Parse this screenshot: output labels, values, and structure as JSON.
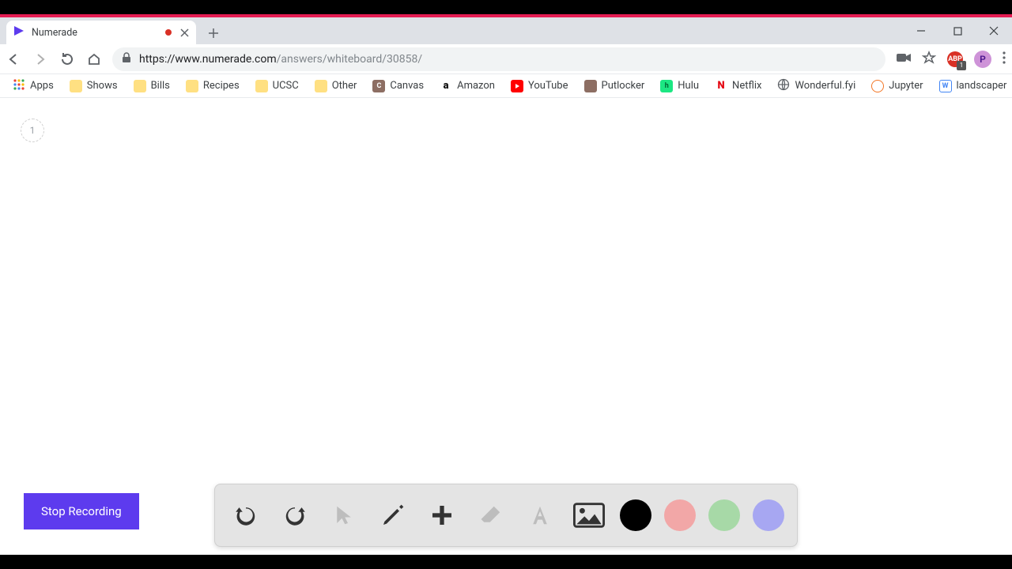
{
  "tab": {
    "title": "Numerade"
  },
  "url": {
    "prefix": "https://www.numerade.com",
    "path": "/answers/whiteboard/30858/"
  },
  "extensions": {
    "abp_label": "ABP",
    "abp_badge": "1"
  },
  "profile": {
    "initial": "P"
  },
  "bookmarks": [
    {
      "label": "Apps",
      "icon": "apps"
    },
    {
      "label": "Shows",
      "icon": "folder"
    },
    {
      "label": "Bills",
      "icon": "folder"
    },
    {
      "label": "Recipes",
      "icon": "folder"
    },
    {
      "label": "UCSC",
      "icon": "folder"
    },
    {
      "label": "Other",
      "icon": "folder"
    },
    {
      "label": "Canvas",
      "icon": "canvas"
    },
    {
      "label": "Amazon",
      "icon": "amazon"
    },
    {
      "label": "YouTube",
      "icon": "youtube"
    },
    {
      "label": "Putlocker",
      "icon": "putlocker"
    },
    {
      "label": "Hulu",
      "icon": "hulu"
    },
    {
      "label": "Netflix",
      "icon": "netflix"
    },
    {
      "label": "Wonderful.fyi",
      "icon": "globe"
    },
    {
      "label": "Jupyter",
      "icon": "jupyter"
    },
    {
      "label": "landscaper",
      "icon": "landscaper"
    }
  ],
  "bm_overflow": "»",
  "whiteboard": {
    "page_number": "1",
    "stop_label": "Stop Recording",
    "tools": [
      {
        "name": "undo"
      },
      {
        "name": "redo"
      },
      {
        "name": "pointer"
      },
      {
        "name": "pencil"
      },
      {
        "name": "add"
      },
      {
        "name": "eraser"
      },
      {
        "name": "text"
      },
      {
        "name": "image"
      }
    ],
    "colors": {
      "black": "#000000",
      "red": "#f2a7a7",
      "green": "#a7d9a7",
      "blue": "#a7a7f2"
    }
  }
}
